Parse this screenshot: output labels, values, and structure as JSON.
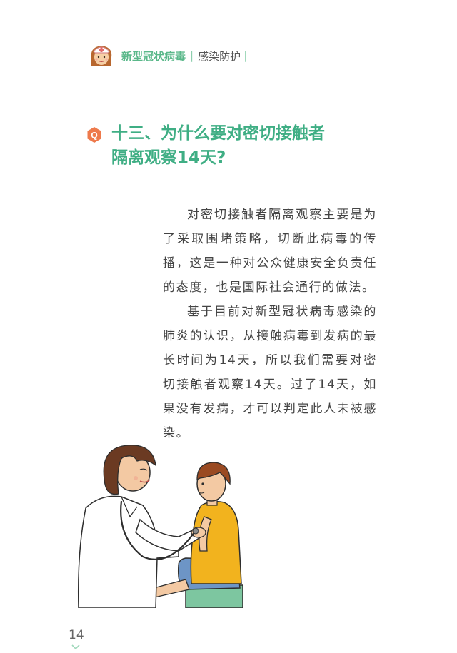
{
  "header": {
    "series_title": "新型冠状病毒",
    "series_subtitle": "感染防护"
  },
  "question": {
    "badge": "Q",
    "title_line1": "十三、为什么要对密切接触者",
    "title_line2": "隔离观察14天?"
  },
  "body": {
    "paragraph1": "对密切接触者隔离观察主要是为了采取围堵策略，切断此病毒的传播，这是一种对公众健康安全负责任的态度，也是国际社会通行的做法。",
    "paragraph2": "基于目前对新型冠状病毒感染的肺炎的认识，从接触病毒到发病的最长时间为14天，所以我们需要对密切接触者观察14天。过了14天，如果没有发病，才可以判定此人未被感染。"
  },
  "footer": {
    "page_number": "14"
  },
  "colors": {
    "accent_green": "#3fae84",
    "badge_orange": "#ee7a4c",
    "shirt_yellow": "#f2b31e",
    "shorts_blue": "#6d95c6",
    "stool_green": "#7dc6a0"
  },
  "icons": {
    "header": "nurse-avatar-icon",
    "question": "q-badge-icon",
    "footer": "chevron-down-icon"
  }
}
